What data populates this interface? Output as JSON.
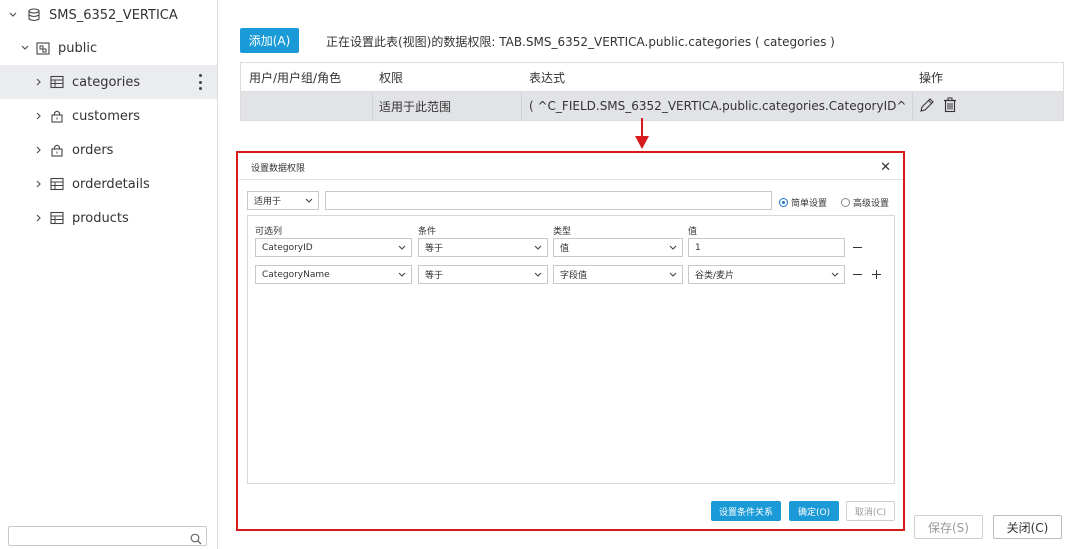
{
  "sidebar": {
    "root": {
      "label": "SMS_6352_VERTICA",
      "icon": "database-icon"
    },
    "schema": {
      "label": "public",
      "icon": "schema-icon"
    },
    "items": [
      {
        "label": "categories",
        "icon": "table-icon",
        "selected": true
      },
      {
        "label": "customers",
        "icon": "lock-icon"
      },
      {
        "label": "orders",
        "icon": "lock-icon"
      },
      {
        "label": "orderdetails",
        "icon": "table-icon"
      },
      {
        "label": "products",
        "icon": "table-icon"
      }
    ],
    "search": {
      "value": "",
      "placeholder": ""
    }
  },
  "toolbar": {
    "add_label": "添加(A)",
    "info_text": "正在设置此表(视图)的数据权限: TAB.SMS_6352_VERTICA.public.categories ( categories )"
  },
  "table": {
    "headers": [
      "用户/用户组/角色",
      "权限",
      "表达式",
      "操作"
    ],
    "rows": [
      {
        "user": "",
        "permission": "适用于此范围",
        "expression": "( ^C_FIELD.SMS_6352_VERTICA.public.categories.CategoryID^ ..."
      }
    ]
  },
  "dialog": {
    "title": "设置数据权限",
    "scope_select": "适用于",
    "expression_value": "",
    "radio_simple": "简单设置",
    "radio_advanced": "高级设置",
    "columns": [
      "可选列",
      "条件",
      "类型",
      "值"
    ],
    "conditions": [
      {
        "column": "CategoryID",
        "operator": "等于",
        "type": "值",
        "value": "1"
      },
      {
        "column": "CategoryName",
        "operator": "等于",
        "type": "字段值",
        "value": "谷类/麦片"
      }
    ],
    "btn_relation": "设置条件关系",
    "btn_ok": "确定(O)",
    "btn_cancel": "取消(C)"
  },
  "footer": {
    "save_label": "保存(S)",
    "close_label": "关闭(C)"
  },
  "colors": {
    "accent": "#1a9bd7",
    "highlight_border": "#d71a1a",
    "selected_row": "#e1e3e6"
  }
}
